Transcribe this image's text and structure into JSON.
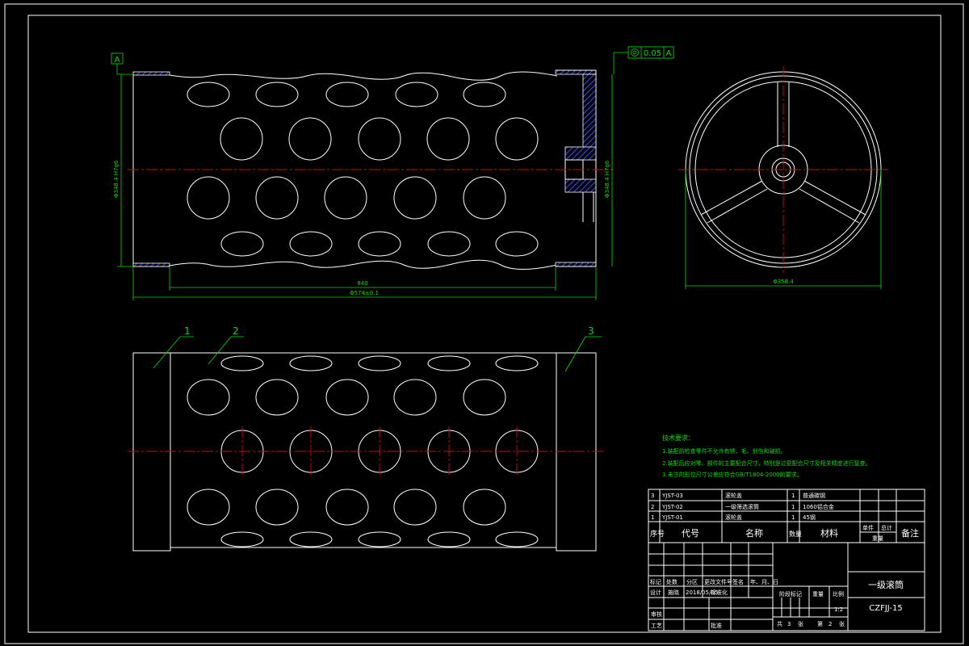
{
  "colors": {
    "background": "#000000",
    "outline": "#ffffff",
    "dimension": "#00e000",
    "centerline": "#e00000",
    "hatch": "#3a50ff"
  },
  "datum": {
    "letter": "A"
  },
  "tolerance": {
    "symbol": "concentricity-icon",
    "value": "0.05",
    "datum": "A"
  },
  "dimensions": {
    "left_dia": "Φ348.4 H7g6",
    "right_dia": "Φ348.4 H7g6",
    "inner_len": "840",
    "total_len": "Φ574±0.1",
    "end_dia": "Φ358.4"
  },
  "part_labels": [
    "1",
    "2",
    "3"
  ],
  "notes": {
    "title": "技术要求：",
    "lines": [
      "1.装配前检查零件不允许有锈、毛、划伤和破损。",
      "2.装配后应对零、部件的主要配合尺寸，特别是过盈配合尺寸及相关精度进行复查。",
      "3.未注的形位尺寸公差应符合GB/T1804-2000的要求。"
    ]
  },
  "bom": {
    "rows": [
      {
        "no": "3",
        "code": "YJST-03",
        "name": "滚轮盖",
        "qty": "1",
        "material": "普通碳钢"
      },
      {
        "no": "2",
        "code": "YJST-02",
        "name": "一级筛选滚筒",
        "qty": "1",
        "material": "1060铝合金"
      },
      {
        "no": "1",
        "code": "YJST-01",
        "name": "滚轮盖",
        "qty": "1",
        "material": "45钢"
      }
    ],
    "header": {
      "no": "序号",
      "code": "代号",
      "name": "名称",
      "qty": "数量",
      "material": "材料",
      "unit": "单件",
      "total": "总计",
      "weight": "重量",
      "remark": "备注"
    }
  },
  "titleblock": {
    "row_mark": [
      "标记",
      "处数",
      "分区",
      "更改文件号",
      "签名",
      "年、月、日"
    ],
    "row_design": [
      "设计",
      "施晓",
      "2018/05/05",
      "标准化"
    ],
    "stage_label": "阶段标记",
    "weight_label": "重量",
    "scale_label": "比例",
    "scale_value": "1:2",
    "review": "审核",
    "process": "工艺",
    "approve": "批准",
    "sheets": [
      "共",
      "3",
      "张",
      "第",
      "2",
      "张"
    ],
    "part_name": "一级滚筒",
    "drawing_no": "CZFJJ-15"
  }
}
